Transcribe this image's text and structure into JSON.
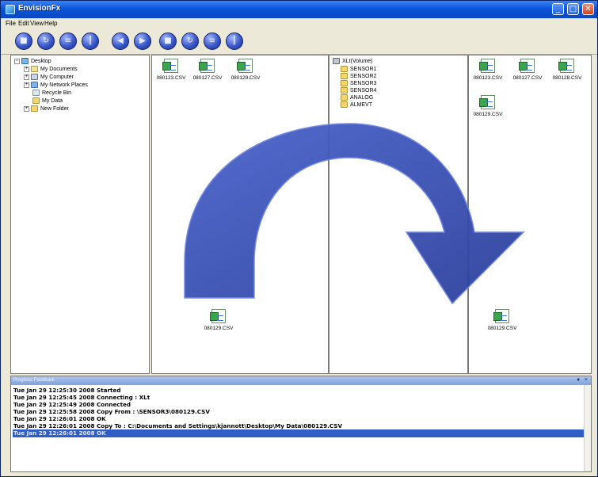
{
  "window": {
    "title": "EnvisionFx",
    "controls": {
      "minimize": "_",
      "maximize": "□",
      "close": "✕"
    }
  },
  "menu": {
    "file": "File",
    "edit": "Edit",
    "view": "View",
    "help": "Help"
  },
  "toolbar": {
    "buttons": [
      {
        "icon": "stop-icon"
      },
      {
        "icon": "refresh-icon"
      },
      {
        "icon": "list-icon"
      },
      {
        "icon": "columns-icon"
      },
      {
        "icon": "back-icon"
      },
      {
        "icon": "forward-icon"
      },
      {
        "icon": "stop-icon"
      },
      {
        "icon": "refresh-icon"
      },
      {
        "icon": "list-icon"
      },
      {
        "icon": "columns-icon"
      }
    ]
  },
  "left_tree": {
    "items": [
      {
        "label": "Desktop",
        "icon": "desktop-icon",
        "expander": "−"
      },
      {
        "label": "My Documents",
        "icon": "folder-icon",
        "expander": "+"
      },
      {
        "label": "My Computer",
        "icon": "computer-icon",
        "expander": "+"
      },
      {
        "label": "My Network Places",
        "icon": "network-icon",
        "expander": "+"
      },
      {
        "label": "Recycle Bin",
        "icon": "recycle-bin-icon",
        "expander": ""
      },
      {
        "label": "My Data",
        "icon": "folder-icon",
        "expander": ""
      },
      {
        "label": "New Folder",
        "icon": "folder-icon",
        "expander": "+"
      }
    ]
  },
  "left_files": {
    "items": [
      "080123.CSV",
      "080127.CSV",
      "080129.CSV"
    ],
    "copied": "080129.CSV"
  },
  "right_tree": {
    "items": [
      {
        "label": "XLt(Volume)",
        "icon": "drive-icon"
      },
      {
        "label": "SENSOR1",
        "icon": "folder-icon"
      },
      {
        "label": "SENSOR2",
        "icon": "folder-icon"
      },
      {
        "label": "SENSOR3",
        "icon": "folder-icon"
      },
      {
        "label": "SENSOR4",
        "icon": "folder-icon"
      },
      {
        "label": "ANALOG",
        "icon": "folder-icon"
      },
      {
        "label": "ALMEVT",
        "icon": "folder-icon"
      }
    ]
  },
  "right_files": {
    "items": [
      "080123.CSV",
      "080127.CSV",
      "080128.CSV",
      "080129.CSV"
    ],
    "copied": "080129.CSV"
  },
  "feedback": {
    "title": "Progress Feedback",
    "pin": "♦",
    "close": "×",
    "lines": [
      "Tue Jan 29 12:25:30 2008 Started",
      "Tue Jan 29 12:25:45 2008 Connecting : XLt",
      "Tue Jan 29 12:25:49 2008 Connected",
      "Tue Jan 29 12:25:58 2008 Copy From : \\SENSOR3\\080129.CSV",
      "Tue Jan 29 12:26:01 2008 OK",
      "Tue Jan 29 12:26:01 2008 Copy To   : C:\\Documents and Settings\\kjannott\\Desktop\\My Data\\080129.CSV",
      "Tue Jan 29 12:26:01 2008 OK"
    ]
  },
  "colors": {
    "arrow": "#3d52b8",
    "selection": "#2f5fc4",
    "titlebar": "#0b55d8"
  }
}
